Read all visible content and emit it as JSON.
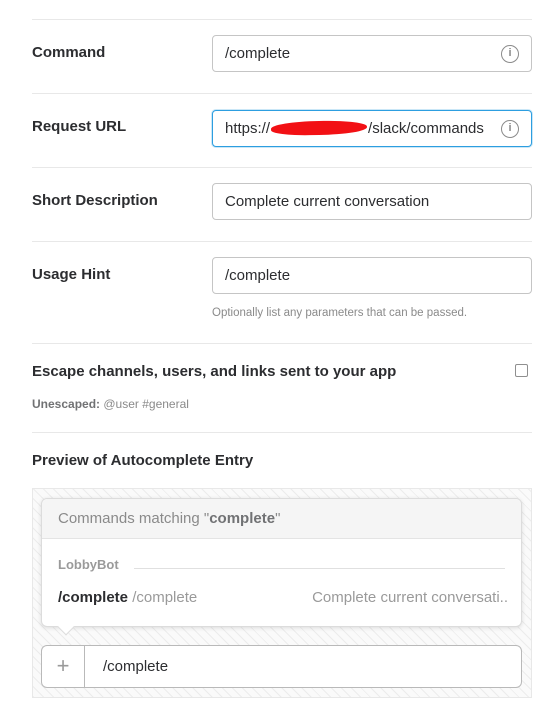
{
  "fields": {
    "command": {
      "label": "Command",
      "value": "/complete",
      "info_icon": "info-icon"
    },
    "request_url": {
      "label": "Request URL",
      "value_prefix": "https://",
      "value_suffix": "/slack/commands",
      "info_icon": "info-icon"
    },
    "short_description": {
      "label": "Short Description",
      "value": "Complete current conversation"
    },
    "usage_hint": {
      "label": "Usage Hint",
      "value": "/complete",
      "help": "Optionally list any parameters that can be passed."
    }
  },
  "escape": {
    "label": "Escape channels, users, and links sent to your app",
    "checked": false,
    "note_prefix": "Unescaped:",
    "note_value": "@user #general"
  },
  "preview": {
    "title": "Preview of Autocomplete Entry",
    "popup": {
      "header_prefix": "Commands matching \"",
      "header_term": "complete",
      "header_suffix": "\"",
      "group": "LobbyBot",
      "command": "/complete",
      "usage": "/complete",
      "description": "Complete current conversati.."
    },
    "message_input": {
      "plus": "+",
      "text": "/complete"
    }
  },
  "colors": {
    "focus_border": "#2d9ee0",
    "redaction": "#f21014"
  }
}
